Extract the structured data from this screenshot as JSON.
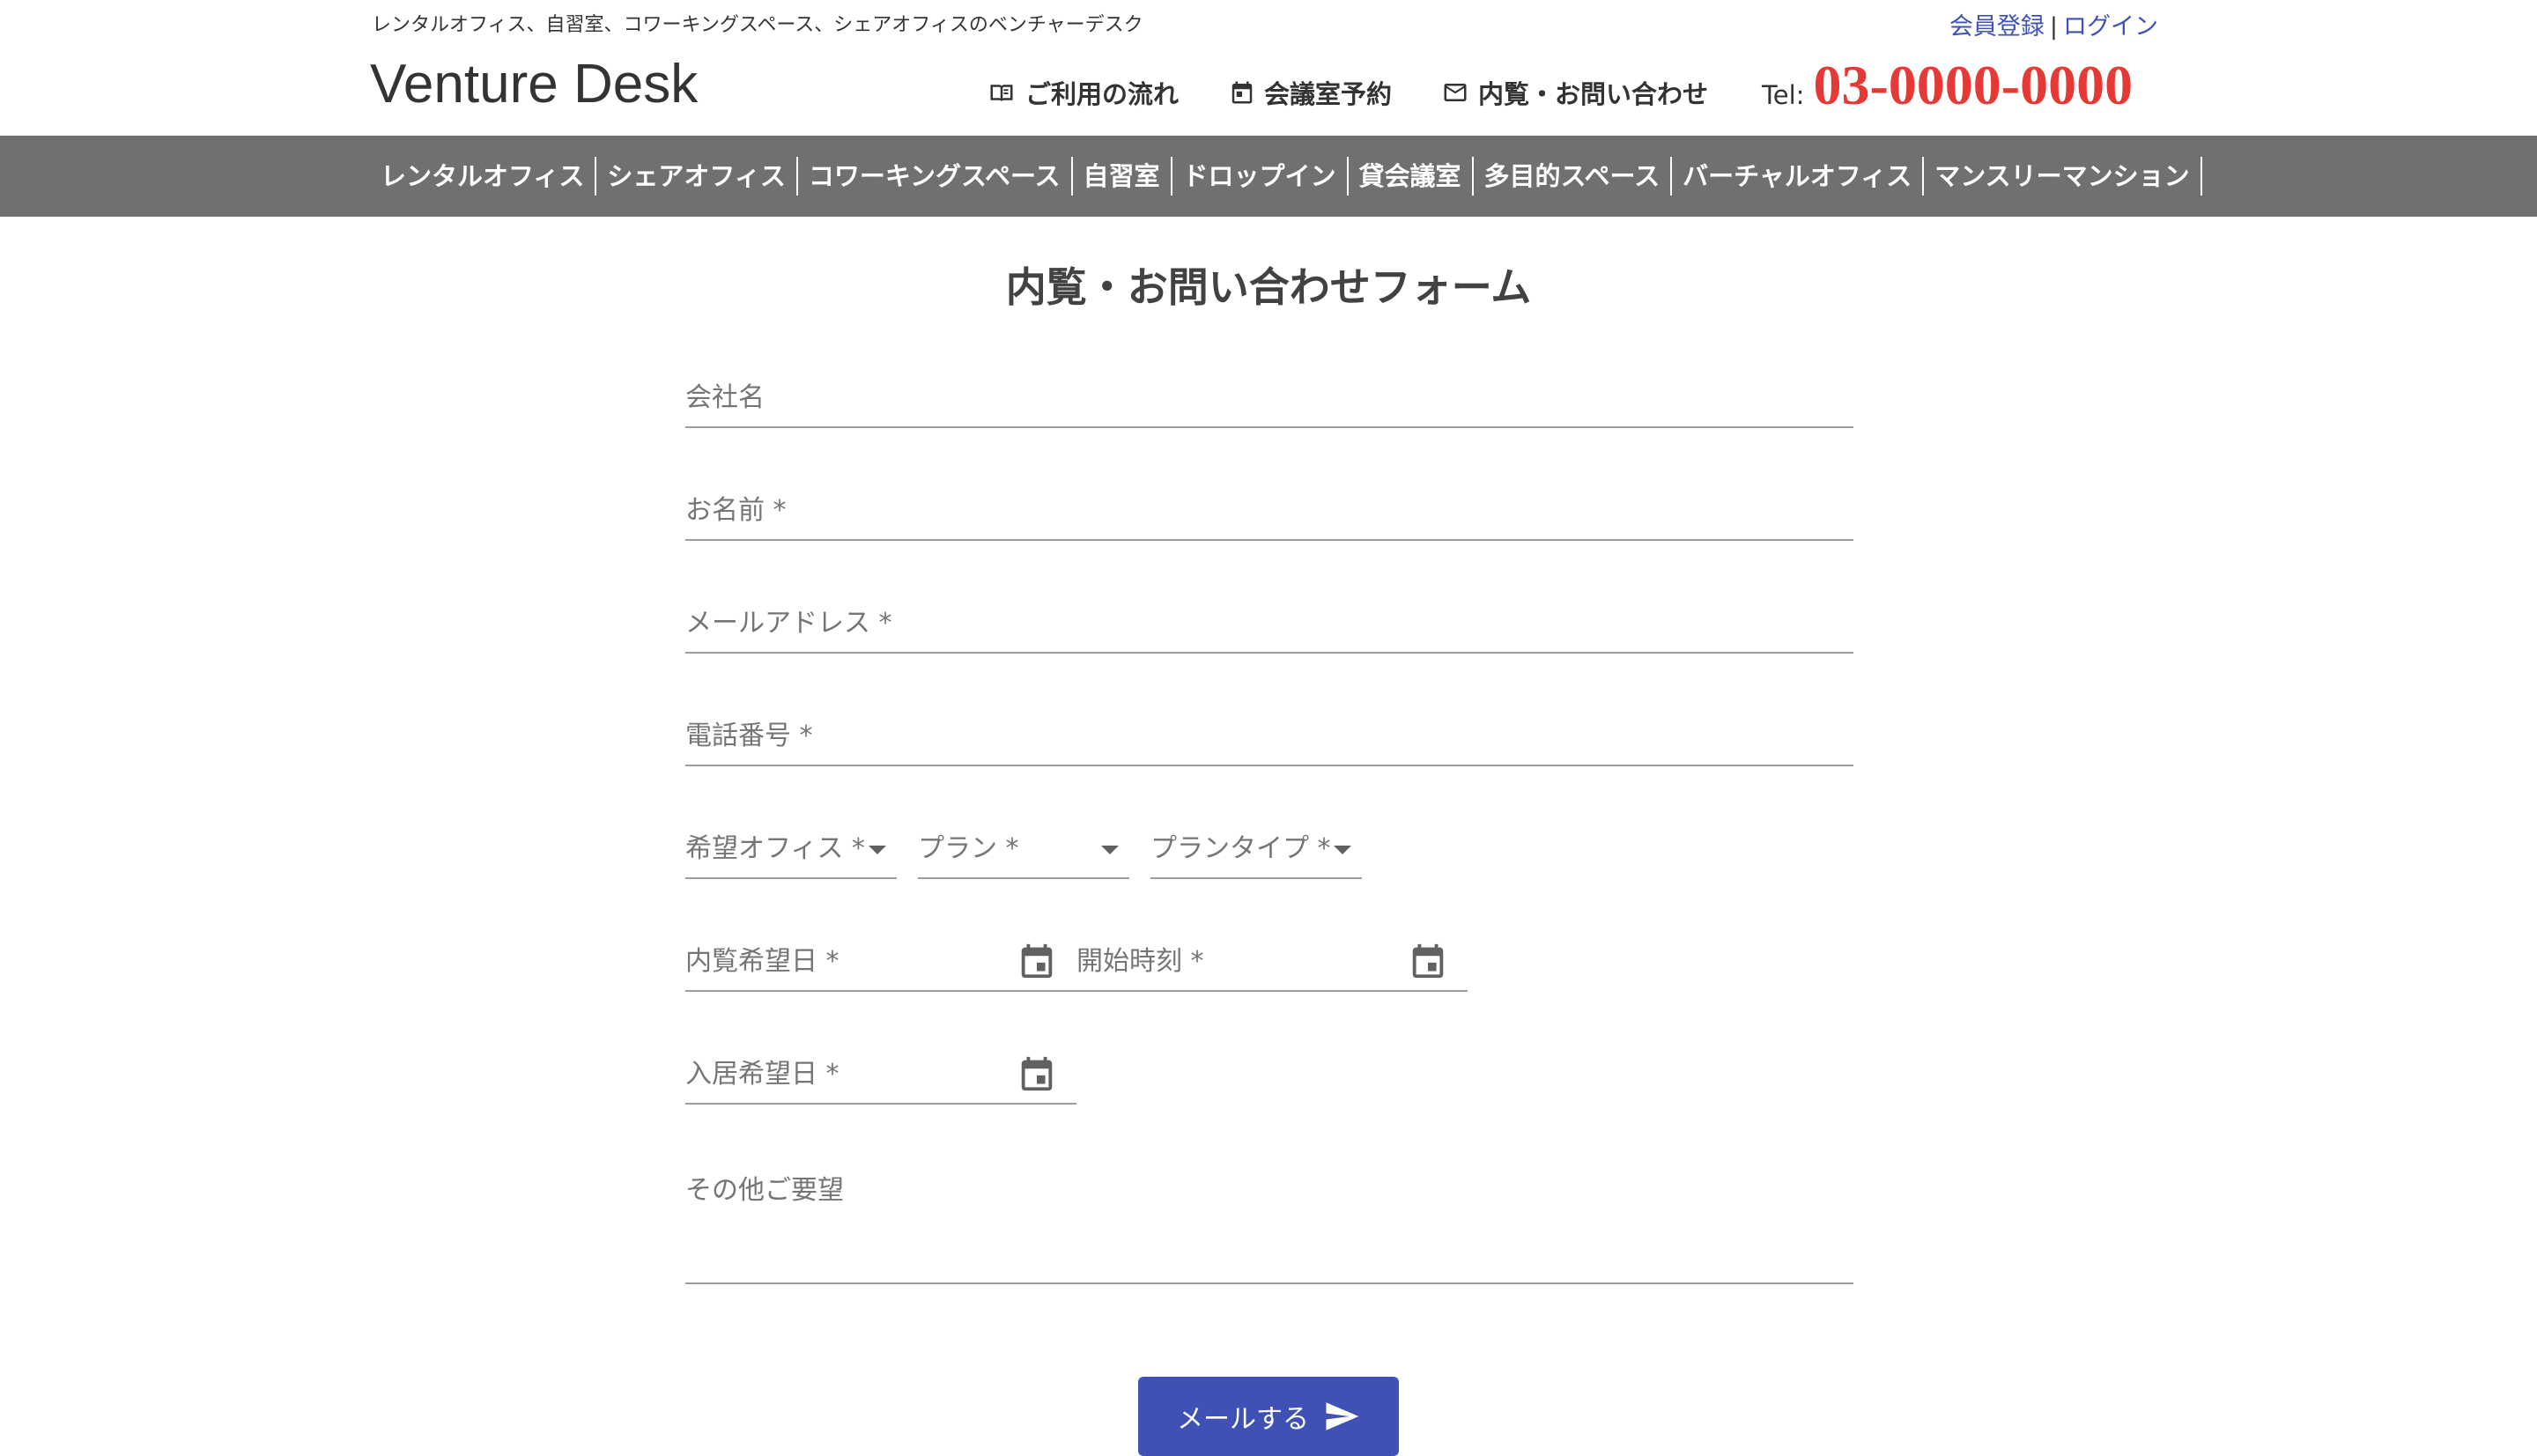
{
  "header": {
    "tagline": "レンタルオフィス、自習室、コワーキングスペース、シェアオフィスのベンチャーデスク",
    "auth": {
      "register": "会員登録",
      "separator": "|",
      "login": "ログイン"
    },
    "logo": "Venture Desk",
    "nav": {
      "flow": "ご利用の流れ",
      "reserve": "会議室予約",
      "contact": "内覧・お問い合わせ"
    },
    "tel_label": "Tel:",
    "tel_number": "03-0000-0000"
  },
  "navbar": {
    "items": [
      "レンタルオフィス",
      "シェアオフィス",
      "コワーキングスペース",
      "自習室",
      "ドロップイン",
      "貸会議室",
      "多目的スペース",
      "バーチャルオフィス",
      "マンスリーマンション"
    ]
  },
  "form": {
    "title": "内覧・お問い合わせフォーム",
    "company": "会社名",
    "name": "お名前 *",
    "email": "メールアドレス *",
    "phone": "電話番号 *",
    "office": "希望オフィス *",
    "plan": "プラン *",
    "plan_type": "プランタイプ *",
    "visit_date": "内覧希望日 *",
    "start_time": "開始時刻 *",
    "move_in_date": "入居希望日 *",
    "other": "その他ご要望",
    "submit": "メールする"
  },
  "colors": {
    "accent": "#3f51b5",
    "tel": "#e53935",
    "navbar": "#707070"
  },
  "icons": {
    "flow": "book-icon",
    "reserve": "calendar-icon",
    "contact": "mail-icon",
    "submit": "send-icon",
    "date": "calendar-icon"
  }
}
